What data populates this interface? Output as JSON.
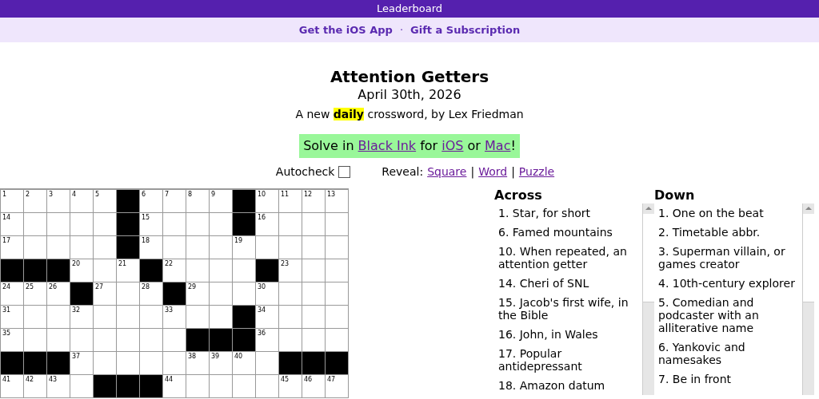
{
  "top_bar": {
    "label": "Leaderboard"
  },
  "promo_bar": {
    "links": [
      "Get the iOS App",
      "Gift a Subscription"
    ],
    "separator": "·"
  },
  "puzzle": {
    "title": "Attention Getters",
    "date": "April 30th, 2026",
    "byline": "A new **daily** crossword, by Lex Friedman"
  },
  "solve_banner": {
    "parts": [
      {
        "kind": "text",
        "text": "Solve in "
      },
      {
        "kind": "link",
        "text": "Black Ink"
      },
      {
        "kind": "text",
        "text": " for "
      },
      {
        "kind": "link",
        "text": "iOS"
      },
      {
        "kind": "text",
        "text": " or "
      },
      {
        "kind": "link",
        "text": "Mac"
      },
      {
        "kind": "text",
        "text": "!"
      }
    ]
  },
  "controls": {
    "autocheck": {
      "label": "Autocheck",
      "checked": false
    },
    "reveal": {
      "label": "Reveal:",
      "links": [
        "Square",
        "Word",
        "Puzzle"
      ],
      "separator": "|"
    }
  },
  "grid": [
    [
      {
        "kind": "open",
        "number": "1"
      },
      {
        "kind": "open",
        "number": "2"
      },
      {
        "kind": "open",
        "number": "3"
      },
      {
        "kind": "open",
        "number": "4"
      },
      {
        "kind": "open",
        "number": "5"
      },
      {
        "kind": "block"
      },
      {
        "kind": "open",
        "number": "6"
      },
      {
        "kind": "open",
        "number": "7"
      },
      {
        "kind": "open",
        "number": "8"
      },
      {
        "kind": "open",
        "number": "9"
      },
      {
        "kind": "block"
      },
      {
        "kind": "open",
        "number": "10"
      },
      {
        "kind": "open",
        "number": "11"
      },
      {
        "kind": "open",
        "number": "12"
      },
      {
        "kind": "open",
        "number": "13"
      }
    ],
    [
      {
        "kind": "open",
        "number": "14"
      },
      {
        "kind": "open"
      },
      {
        "kind": "open"
      },
      {
        "kind": "open"
      },
      {
        "kind": "open"
      },
      {
        "kind": "block"
      },
      {
        "kind": "open",
        "number": "15"
      },
      {
        "kind": "open"
      },
      {
        "kind": "open"
      },
      {
        "kind": "open"
      },
      {
        "kind": "block"
      },
      {
        "kind": "open",
        "number": "16"
      },
      {
        "kind": "open"
      },
      {
        "kind": "open"
      },
      {
        "kind": "open"
      }
    ],
    [
      {
        "kind": "open",
        "number": "17"
      },
      {
        "kind": "open"
      },
      {
        "kind": "open"
      },
      {
        "kind": "open"
      },
      {
        "kind": "open"
      },
      {
        "kind": "block"
      },
      {
        "kind": "open",
        "number": "18"
      },
      {
        "kind": "open"
      },
      {
        "kind": "open"
      },
      {
        "kind": "open"
      },
      {
        "kind": "open",
        "number": "19"
      },
      {
        "kind": "open"
      },
      {
        "kind": "open"
      },
      {
        "kind": "open"
      },
      {
        "kind": "open"
      }
    ],
    [
      {
        "kind": "block"
      },
      {
        "kind": "block"
      },
      {
        "kind": "block"
      },
      {
        "kind": "open",
        "number": "20"
      },
      {
        "kind": "open"
      },
      {
        "kind": "open",
        "number": "21"
      },
      {
        "kind": "block"
      },
      {
        "kind": "open",
        "number": "22"
      },
      {
        "kind": "open"
      },
      {
        "kind": "open"
      },
      {
        "kind": "open"
      },
      {
        "kind": "block"
      },
      {
        "kind": "open",
        "number": "23"
      },
      {
        "kind": "open"
      },
      {
        "kind": "open"
      }
    ],
    [
      {
        "kind": "open",
        "number": "24"
      },
      {
        "kind": "open",
        "number": "25"
      },
      {
        "kind": "open",
        "number": "26"
      },
      {
        "kind": "block"
      },
      {
        "kind": "open",
        "number": "27"
      },
      {
        "kind": "open"
      },
      {
        "kind": "open",
        "number": "28"
      },
      {
        "kind": "block"
      },
      {
        "kind": "open",
        "number": "29"
      },
      {
        "kind": "open"
      },
      {
        "kind": "open"
      },
      {
        "kind": "open",
        "number": "30"
      },
      {
        "kind": "open"
      },
      {
        "kind": "open"
      },
      {
        "kind": "open"
      }
    ],
    [
      {
        "kind": "open",
        "number": "31"
      },
      {
        "kind": "open"
      },
      {
        "kind": "open"
      },
      {
        "kind": "open",
        "number": "32"
      },
      {
        "kind": "open"
      },
      {
        "kind": "open"
      },
      {
        "kind": "open"
      },
      {
        "kind": "open",
        "number": "33"
      },
      {
        "kind": "open"
      },
      {
        "kind": "open"
      },
      {
        "kind": "block"
      },
      {
        "kind": "open",
        "number": "34"
      },
      {
        "kind": "open"
      },
      {
        "kind": "open"
      },
      {
        "kind": "open"
      }
    ],
    [
      {
        "kind": "open",
        "number": "35"
      },
      {
        "kind": "open"
      },
      {
        "kind": "open"
      },
      {
        "kind": "open"
      },
      {
        "kind": "open"
      },
      {
        "kind": "open"
      },
      {
        "kind": "open"
      },
      {
        "kind": "open"
      },
      {
        "kind": "block"
      },
      {
        "kind": "block"
      },
      {
        "kind": "block"
      },
      {
        "kind": "open",
        "number": "36"
      },
      {
        "kind": "open"
      },
      {
        "kind": "open"
      },
      {
        "kind": "open"
      }
    ],
    [
      {
        "kind": "block"
      },
      {
        "kind": "block"
      },
      {
        "kind": "block"
      },
      {
        "kind": "open",
        "number": "37"
      },
      {
        "kind": "open"
      },
      {
        "kind": "open"
      },
      {
        "kind": "open"
      },
      {
        "kind": "open"
      },
      {
        "kind": "open",
        "number": "38"
      },
      {
        "kind": "open",
        "number": "39"
      },
      {
        "kind": "open",
        "number": "40"
      },
      {
        "kind": "open"
      },
      {
        "kind": "block"
      },
      {
        "kind": "block"
      },
      {
        "kind": "block"
      }
    ],
    [
      {
        "kind": "open",
        "number": "41"
      },
      {
        "kind": "open",
        "number": "42"
      },
      {
        "kind": "open",
        "number": "43"
      },
      {
        "kind": "open"
      },
      {
        "kind": "block"
      },
      {
        "kind": "block"
      },
      {
        "kind": "block"
      },
      {
        "kind": "open",
        "number": "44"
      },
      {
        "kind": "open"
      },
      {
        "kind": "open"
      },
      {
        "kind": "open"
      },
      {
        "kind": "open"
      },
      {
        "kind": "open",
        "number": "45"
      },
      {
        "kind": "open",
        "number": "46"
      },
      {
        "kind": "open",
        "number": "47"
      }
    ]
  ],
  "clues": [
    {
      "heading": "Across",
      "items": [
        "1. Star, for short",
        "6. Famed mountains",
        "10. When repeated, an attention getter",
        "14. Cheri of SNL",
        "15. Jacob's first wife, in the Bible",
        "16. John, in Wales",
        "17. Popular antidepressant",
        "18. Amazon datum"
      ]
    },
    {
      "heading": "Down",
      "items": [
        "1. One on the beat",
        "2. Timetable abbr.",
        "3. Superman villain, or games creator",
        "4. 10th-century explorer",
        "5. Comedian and podcaster with an alliterative name",
        "6. Yankovic and namesakes",
        "7. Be in front"
      ]
    }
  ]
}
